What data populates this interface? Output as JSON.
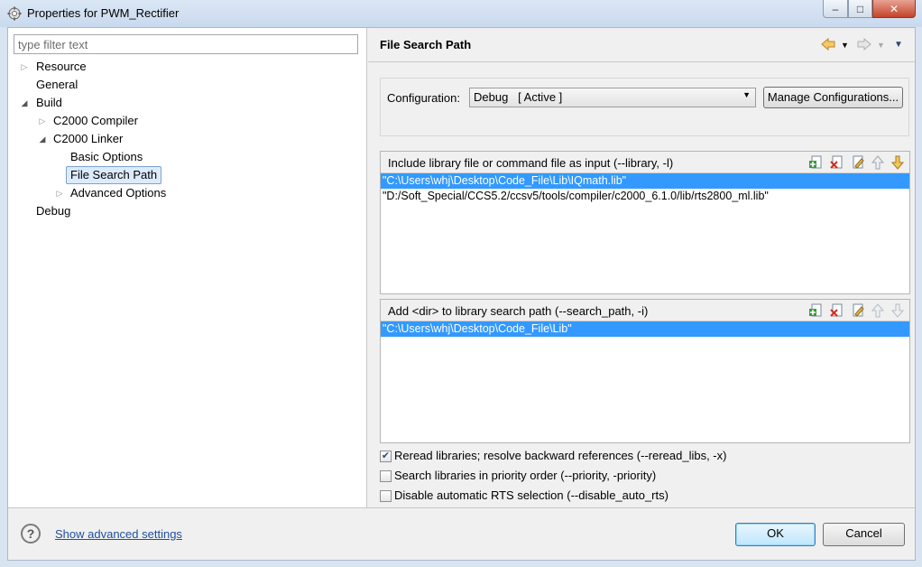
{
  "window": {
    "title": "Properties for PWM_Rectifier",
    "controls": {
      "minimize": "–",
      "maximize": "□",
      "close": "✕"
    }
  },
  "filter": {
    "placeholder": "type filter text",
    "value": ""
  },
  "tree": {
    "resource": "Resource",
    "general": "General",
    "build": "Build",
    "c2000_compiler": "C2000 Compiler",
    "c2000_linker": "C2000 Linker",
    "basic_options": "Basic Options",
    "file_search_path": "File Search Path",
    "advanced_options": "Advanced Options",
    "debug": "Debug"
  },
  "page": {
    "title": "File Search Path",
    "configuration_label": "Configuration:",
    "configuration_value": "Debug   [ Active ]",
    "manage_button": "Manage Configurations..."
  },
  "library_list": {
    "header": "Include library file or command file as input (--library, -l)",
    "items": [
      "\"C:\\Users\\whj\\Desktop\\Code_File\\Lib\\IQmath.lib\"",
      "\"D:/Soft_Special/CCS5.2/ccsv5/tools/compiler/c2000_6.1.0/lib/rts2800_ml.lib\""
    ]
  },
  "search_path_list": {
    "header": "Add <dir> to library search path (--search_path, -i)",
    "items": [
      "\"C:\\Users\\whj\\Desktop\\Code_File\\Lib\""
    ]
  },
  "options": {
    "reread": {
      "label": "Reread libraries; resolve backward references (--reread_libs, -x)",
      "checked": true
    },
    "priority": {
      "label": "Search libraries in priority order (--priority, -priority)",
      "checked": false
    },
    "disable_rts": {
      "label": "Disable automatic RTS selection (--disable_auto_rts)",
      "checked": false
    }
  },
  "footer": {
    "help": "?",
    "advanced_link": "Show advanced settings",
    "ok": "OK",
    "cancel": "Cancel"
  },
  "colors": {
    "selection": "#3399ff",
    "tree_selection": "#dcebfc",
    "link": "#1f4f9e"
  }
}
